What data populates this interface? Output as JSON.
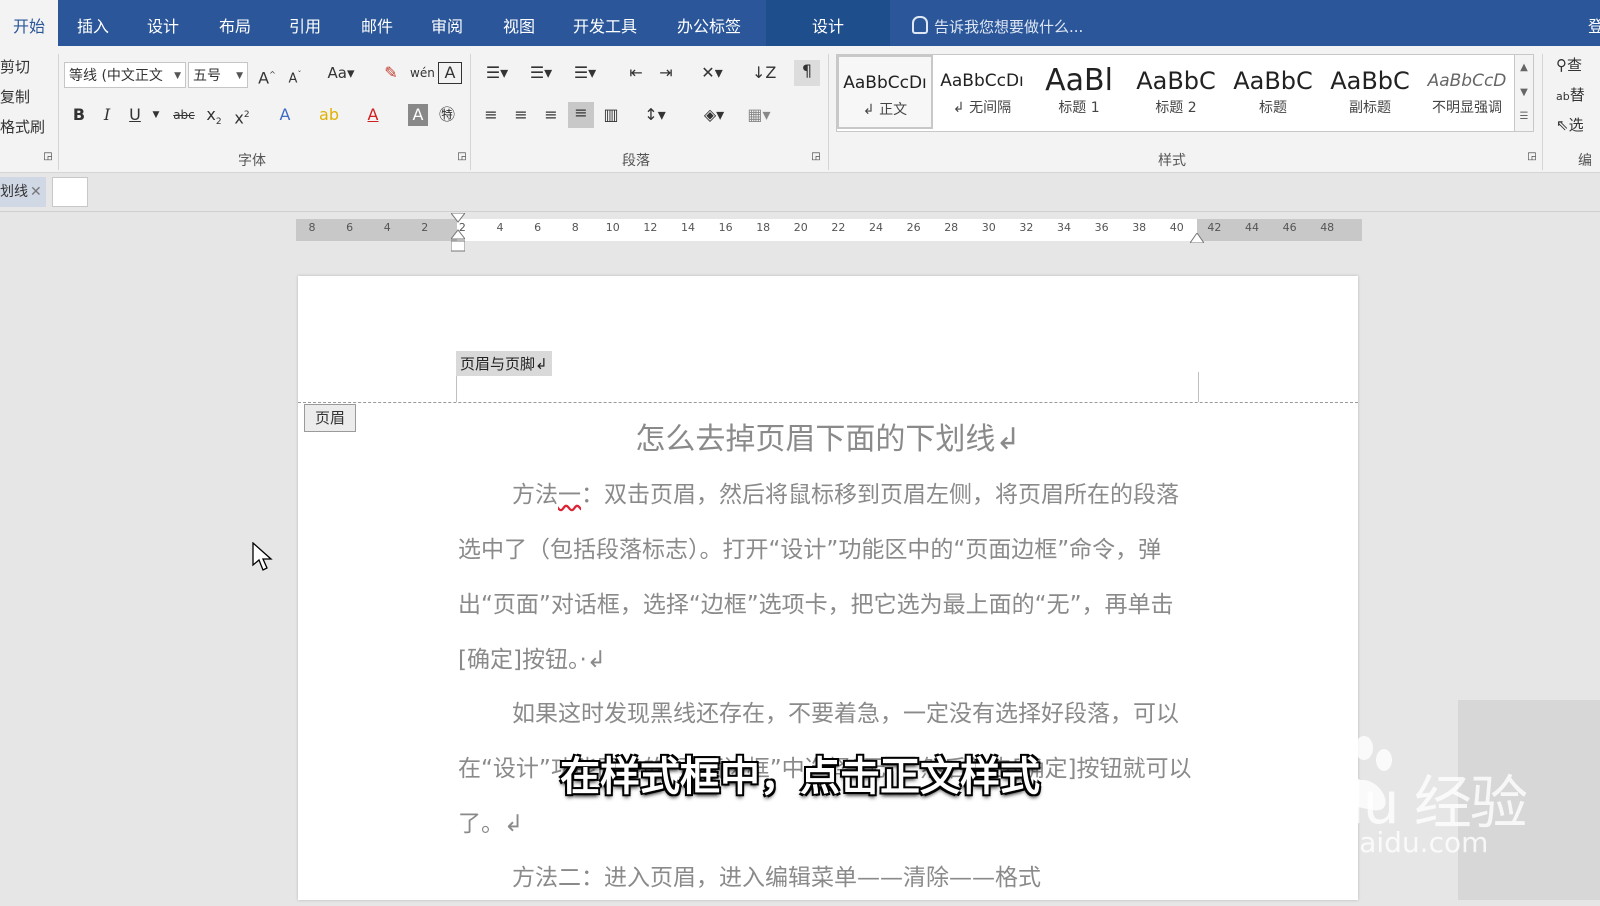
{
  "ribbon_tabs": [
    {
      "label": "开始",
      "active": true
    },
    {
      "label": "插入"
    },
    {
      "label": "设计"
    },
    {
      "label": "布局"
    },
    {
      "label": "引用"
    },
    {
      "label": "邮件"
    },
    {
      "label": "审阅"
    },
    {
      "label": "视图"
    },
    {
      "label": "开发工具"
    },
    {
      "label": "办公标签"
    },
    {
      "label": "设计",
      "contextual": true
    }
  ],
  "tell_me": "告诉我您想要做什么...",
  "login": "登",
  "clipboard": {
    "cut": "剪切",
    "copy": "复制",
    "format_painter": "格式刷"
  },
  "font": {
    "name": "等线 (中文正文",
    "size": "五号",
    "group_label": "字体"
  },
  "paragraph": {
    "group_label": "段落"
  },
  "styles": {
    "group_label": "样式",
    "items": [
      {
        "sample": "AaBbCcDı",
        "name": "↲ 正文",
        "selected": true
      },
      {
        "sample": "AaBbCcDı",
        "name": "↲ 无间隔"
      },
      {
        "sample": "AaBl",
        "name": "标题 1"
      },
      {
        "sample": "AaBbC",
        "name": "标题 2"
      },
      {
        "sample": "AaBbC",
        "name": "标题"
      },
      {
        "sample": "AaBbC",
        "name": "副标题"
      },
      {
        "sample": "AaBbCcD",
        "name": "不明显强调"
      }
    ]
  },
  "editing": {
    "find": "查",
    "replace": "替",
    "select": "选",
    "group_label": "编"
  },
  "doc_tab": {
    "label": "划线"
  },
  "ruler": {
    "labels": [
      "8",
      "6",
      "4",
      "2",
      "2",
      "4",
      "6",
      "8",
      "10",
      "12",
      "14",
      "16",
      "18",
      "20",
      "22",
      "24",
      "26",
      "28",
      "30",
      "32",
      "34",
      "36",
      "38",
      "40",
      "42",
      "44",
      "46",
      "48"
    ]
  },
  "document": {
    "header_text": "页眉与页脚↲",
    "header_tag": "页眉",
    "title": "怎么去掉页眉下面的下划线↲",
    "para1_a": "方法",
    "para1_b": "一",
    "para1_c": "：双击页眉，然后将鼠标移到页眉左侧，将页眉所在的段落选中了（包括段落标志）。打开“设计”功能区中的“页面边框”命令，弹出“页面”对话框，选择“边框”选项卡，把它选为最上面的“无”，再单击[确定]按钮。·↲",
    "para2": "如果这时发现黑线还存在，不要着急，一定没有选择好段落，可以在“设计”功能区中的“页面边框”中选择“无”，然后单击[确定]按钮就可以了。↲",
    "para3": "方法二：进入页眉，进入编辑菜单——清除——格式"
  },
  "caption": "在样式框中，点击正文样式",
  "watermark": {
    "brand": "Bai  du 经验",
    "url": "jingyan.baidu.com"
  }
}
